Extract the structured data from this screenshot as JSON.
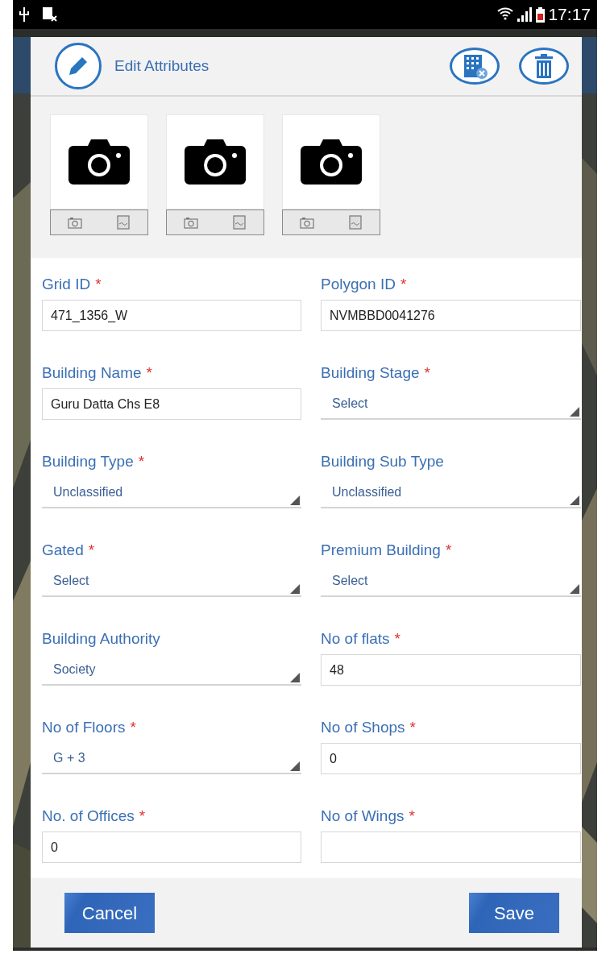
{
  "status_bar": {
    "time": "17:17"
  },
  "dialog": {
    "title": "Edit Attributes"
  },
  "fields": [
    {
      "label": "Grid ID",
      "required_mark": "*",
      "kind": "text",
      "value": "471_1356_W"
    },
    {
      "label": "Polygon ID",
      "required_mark": "*",
      "kind": "text",
      "value": "NVMBBD0041276"
    },
    {
      "label": "Building Name",
      "required_mark": "*",
      "kind": "text",
      "value": "Guru Datta Chs E8"
    },
    {
      "label": "Building Stage",
      "required_mark": "*",
      "kind": "select",
      "value": "Select"
    },
    {
      "label": "Building Type",
      "required_mark": "*",
      "kind": "select",
      "value": "Unclassified"
    },
    {
      "label": "Building Sub Type",
      "kind": "select",
      "value": "Unclassified"
    },
    {
      "label": "Gated",
      "required_mark": "*",
      "kind": "select",
      "value": "Select"
    },
    {
      "label": "Premium Building",
      "required_mark": "*",
      "kind": "select",
      "value": "Select"
    },
    {
      "label": "Building Authority",
      "kind": "select",
      "value": "Society"
    },
    {
      "label": "No of flats",
      "required_mark": "*",
      "kind": "text",
      "value": "48"
    },
    {
      "label": "No of Floors",
      "required_mark": "*",
      "kind": "select",
      "value": "G + 3"
    },
    {
      "label": "No of Shops",
      "required_mark": "*",
      "kind": "text",
      "value": "0"
    },
    {
      "label": "No. of Offices",
      "required_mark": "*",
      "kind": "text",
      "value": "0"
    },
    {
      "label": "No of Wings",
      "required_mark": "*",
      "kind": "text"
    }
  ],
  "buttons": [
    {
      "label": "Cancel"
    },
    {
      "label": "Save"
    }
  ]
}
